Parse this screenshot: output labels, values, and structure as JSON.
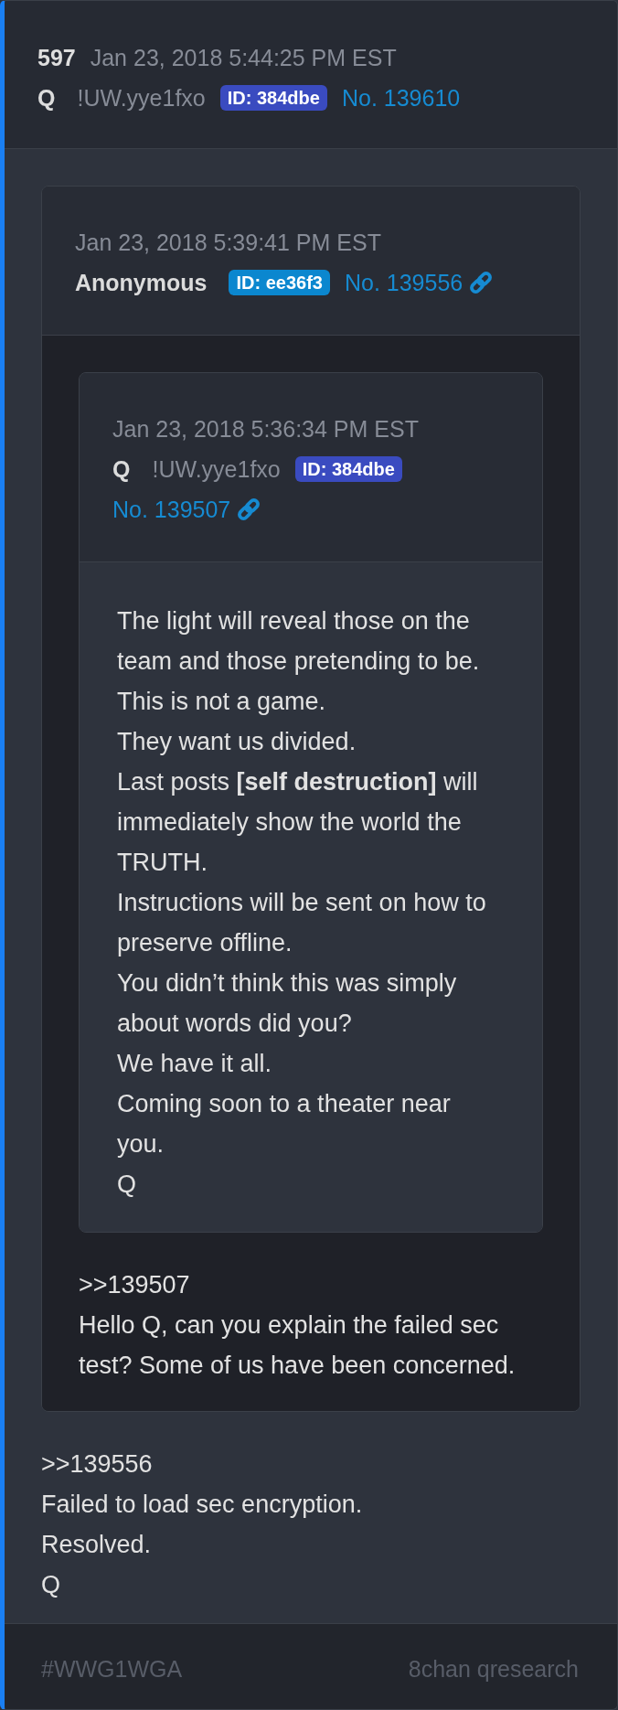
{
  "post": {
    "number": "597",
    "date": "Jan 23, 2018 5:44:25 PM EST",
    "name": "Q",
    "tripcode": "!UW.yye1fxo",
    "id": {
      "label": "ID: 384dbe",
      "color": "#3a4bc0"
    },
    "post_number": "No. 139610",
    "permalink_icon": false,
    "quote": {
      "date": "Jan 23, 2018 5:39:41 PM EST",
      "name": "Anonymous",
      "id": {
        "label": "ID: ee36f3",
        "color": "#0b87cf"
      },
      "post_number": "No. 139556",
      "permalink_icon": true,
      "quote": {
        "date": "Jan 23, 2018 5:36:34 PM EST",
        "name": "Q",
        "tripcode": "!UW.yye1fxo",
        "id": {
          "label": "ID: 384dbe",
          "color": "#3a4bc0"
        },
        "post_number": "No. 139507",
        "permalink_icon": true,
        "lines": [
          "The light will reveal those on the team and those pretending to be.",
          "This is not a game.",
          "They want us divided.",
          "Last posts **[self destruction]** will immediately show the world the TRUTH.",
          "Instructions will be sent on how to preserve offline.",
          "You didn’t think this was simply about words did you?",
          "We have it all.",
          "Coming soon to a theater near you.",
          "Q"
        ]
      },
      "lines": [
        ">>139507",
        "Hello Q, can you explain the failed sec test? Some of us have been concerned."
      ]
    },
    "lines": [
      ">>139556",
      "Failed to load sec encryption.",
      "Resolved.",
      "Q"
    ]
  },
  "footer": {
    "hashtag": "#WWG1WGA",
    "source": "8chan qresearch"
  }
}
